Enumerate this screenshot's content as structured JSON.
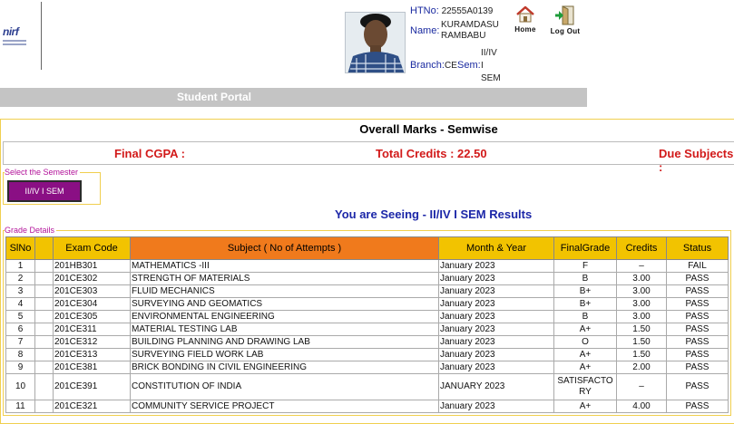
{
  "student": {
    "htno_label": "HTNo:",
    "htno": "22555A0139",
    "name_label": "Name:",
    "name_line1": "KURAMDASU",
    "name_line2": "RAMBABU",
    "branch_label": "Branch:",
    "branch": "CE",
    "sem_label": "Sem:",
    "sem_line1": "II/IV",
    "sem_line2": "I",
    "sem_line3": "SEM"
  },
  "nav": {
    "home_label": "Home",
    "logout_label": "Log Out"
  },
  "portal": {
    "title": "Student Portal"
  },
  "results": {
    "title": "Overall Marks - Semwise",
    "final_cgpa": "Final CGPA :",
    "total_credits": "Total Credits : 22.50",
    "due_subjects": "Due Subjects :",
    "select_semester_legend": "Select the Semester",
    "selected_semester": "II/IV I SEM",
    "seeing_text": "You are Seeing - II/IV I SEM Results",
    "grade_details_legend": "Grade Details",
    "columns": [
      "SlNo",
      "Exam Code",
      "Subject ( No of Attempts )",
      "Month & Year",
      "FinalGrade",
      "Credits",
      "Status"
    ],
    "rows": [
      {
        "slno": "1",
        "code": "201HB301",
        "subject": "MATHEMATICS -III",
        "month": "January 2023",
        "grade": "F",
        "credits": "–",
        "status": "FAIL"
      },
      {
        "slno": "2",
        "code": "201CE302",
        "subject": "STRENGTH OF MATERIALS",
        "month": "January 2023",
        "grade": "B",
        "credits": "3.00",
        "status": "PASS"
      },
      {
        "slno": "3",
        "code": "201CE303",
        "subject": "FLUID MECHANICS",
        "month": "January 2023",
        "grade": "B+",
        "credits": "3.00",
        "status": "PASS"
      },
      {
        "slno": "4",
        "code": "201CE304",
        "subject": "SURVEYING AND GEOMATICS",
        "month": "January 2023",
        "grade": "B+",
        "credits": "3.00",
        "status": "PASS"
      },
      {
        "slno": "5",
        "code": "201CE305",
        "subject": "ENVIRONMENTAL ENGINEERING",
        "month": "January 2023",
        "grade": "B",
        "credits": "3.00",
        "status": "PASS"
      },
      {
        "slno": "6",
        "code": "201CE311",
        "subject": "MATERIAL TESTING LAB",
        "month": "January 2023",
        "grade": "A+",
        "credits": "1.50",
        "status": "PASS"
      },
      {
        "slno": "7",
        "code": "201CE312",
        "subject": "BUILDING PLANNING AND DRAWING LAB",
        "month": "January 2023",
        "grade": "O",
        "credits": "1.50",
        "status": "PASS"
      },
      {
        "slno": "8",
        "code": "201CE313",
        "subject": "SURVEYING FIELD WORK LAB",
        "month": "January 2023",
        "grade": "A+",
        "credits": "1.50",
        "status": "PASS"
      },
      {
        "slno": "9",
        "code": "201CE381",
        "subject": "BRICK BONDING IN CIVIL ENGINEERING",
        "month": "January 2023",
        "grade": "A+",
        "credits": "2.00",
        "status": "PASS"
      },
      {
        "slno": "10",
        "code": "201CE391",
        "subject": "CONSTITUTION OF INDIA",
        "month": "JANUARY 2023",
        "grade": "SATISFACTORY",
        "grade_line1": "SATISFACTO",
        "grade_line2": "RY",
        "credits": "–",
        "status": "PASS"
      },
      {
        "slno": "11",
        "code": "201CE321",
        "subject": "COMMUNITY SERVICE PROJECT",
        "month": "January 2023",
        "grade": "A+",
        "credits": "4.00",
        "status": "PASS"
      }
    ]
  },
  "logo": {
    "text": "nirf"
  },
  "colors": {
    "header_yellow": "#f2c300",
    "subject_orange": "#f07a1c",
    "summary_red": "#d21a1a",
    "seeing_blue": "#1c27a8",
    "legend_magenta": "#b3129a",
    "semester_button": "#8a0f84",
    "portal_bar": "#c4c4c4"
  }
}
